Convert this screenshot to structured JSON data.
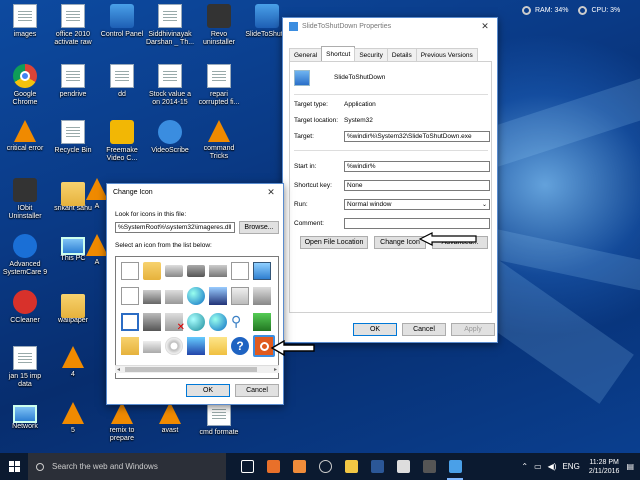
{
  "system_monitor": {
    "ram": "RAM: 34%",
    "cpu": "CPU: 3%"
  },
  "desktop_icons": [
    {
      "label": "images",
      "icon": "doc-icon"
    },
    {
      "label": "office 2010\nactivate raw",
      "icon": "doc-icon"
    },
    {
      "label": "Control Panel",
      "icon": "control-panel-icon"
    },
    {
      "label": "Siddhivinayak\nDarshan _ Th...",
      "icon": "doc-icon"
    },
    {
      "label": "Revo\nuninstaller",
      "icon": "revo-icon"
    },
    {
      "label": "SlideToShut...",
      "icon": "shortcut-icon"
    },
    {
      "label": "Google\nChrome",
      "icon": "chrome-icon"
    },
    {
      "label": "pendrive",
      "icon": "doc-icon"
    },
    {
      "label": "dd",
      "icon": "doc-icon"
    },
    {
      "label": "Stock value a\non 2014-15",
      "icon": "doc-icon"
    },
    {
      "label": "repari\ncorrupted fi...",
      "icon": "doc-icon"
    },
    {
      "label": "critical error",
      "icon": "vlc-icon"
    },
    {
      "label": "Recycle Bin",
      "icon": "recycle-bin-icon"
    },
    {
      "label": "Freemake\nVideo C...",
      "icon": "freemake-icon"
    },
    {
      "label": "VideoScribe",
      "icon": "videoscribe-icon"
    },
    {
      "label": "command\nTricks",
      "icon": "vlc-icon"
    },
    {
      "label": "IObit\nUninstaller",
      "icon": "iobit-icon"
    },
    {
      "label": "srikant sahu",
      "icon": "user-folder-icon"
    },
    {
      "label": "A",
      "icon": "vlc-icon"
    },
    {
      "label": "Advanced\nSystemCare 9",
      "icon": "advanced-systemcare-icon"
    },
    {
      "label": "This PC",
      "icon": "this-pc-icon"
    },
    {
      "label": "A",
      "icon": "vlc-icon"
    },
    {
      "label": "CCleaner",
      "icon": "ccleaner-icon"
    },
    {
      "label": "wallpaper",
      "icon": "user-folder-icon"
    },
    {
      "label": "jan 15 imp\ndata",
      "icon": "doc-icon"
    },
    {
      "label": "4",
      "icon": "vlc-icon"
    },
    {
      "label": "Network",
      "icon": "network-icon"
    },
    {
      "label": "5",
      "icon": "vlc-icon"
    },
    {
      "label": "remix to\nprepare",
      "icon": "vlc-icon"
    },
    {
      "label": "avast",
      "icon": "vlc-icon"
    },
    {
      "label": "cmd formate",
      "icon": "doc-icon"
    }
  ],
  "properties": {
    "title": "SlideToShutDown Properties",
    "tabs": [
      "General",
      "Shortcut",
      "Security",
      "Details",
      "Previous Versions"
    ],
    "name": "SlideToShutDown",
    "target_type_label": "Target type:",
    "target_type": "Application",
    "target_location_label": "Target location:",
    "target_location": "System32",
    "target_label": "Target:",
    "target": "%windir%\\System32\\SlideToShutDown.exe",
    "start_in_label": "Start in:",
    "start_in": "%windir%",
    "shortcut_key_label": "Shortcut key:",
    "shortcut_key": "None",
    "run_label": "Run:",
    "run": "Normal window",
    "comment_label": "Comment:",
    "comment": "",
    "open_file_location": "Open File Location",
    "change_icon": "Change Icon",
    "advanced": "Advanced...",
    "ok": "OK",
    "cancel": "Cancel",
    "apply": "Apply"
  },
  "change_icon": {
    "title": "Change Icon",
    "look_for_label": "Look for icons in this file:",
    "file_path": "%SystemRoot%\\system32\\imageres.dll",
    "browse": "Browse...",
    "select_label": "Select an icon from the list below:",
    "ok": "OK",
    "cancel": "Cancel"
  },
  "taskbar": {
    "search_placeholder": "Search the web and Windows",
    "language": "ENG",
    "time": "11:28 PM",
    "date": "2/11/2016"
  }
}
